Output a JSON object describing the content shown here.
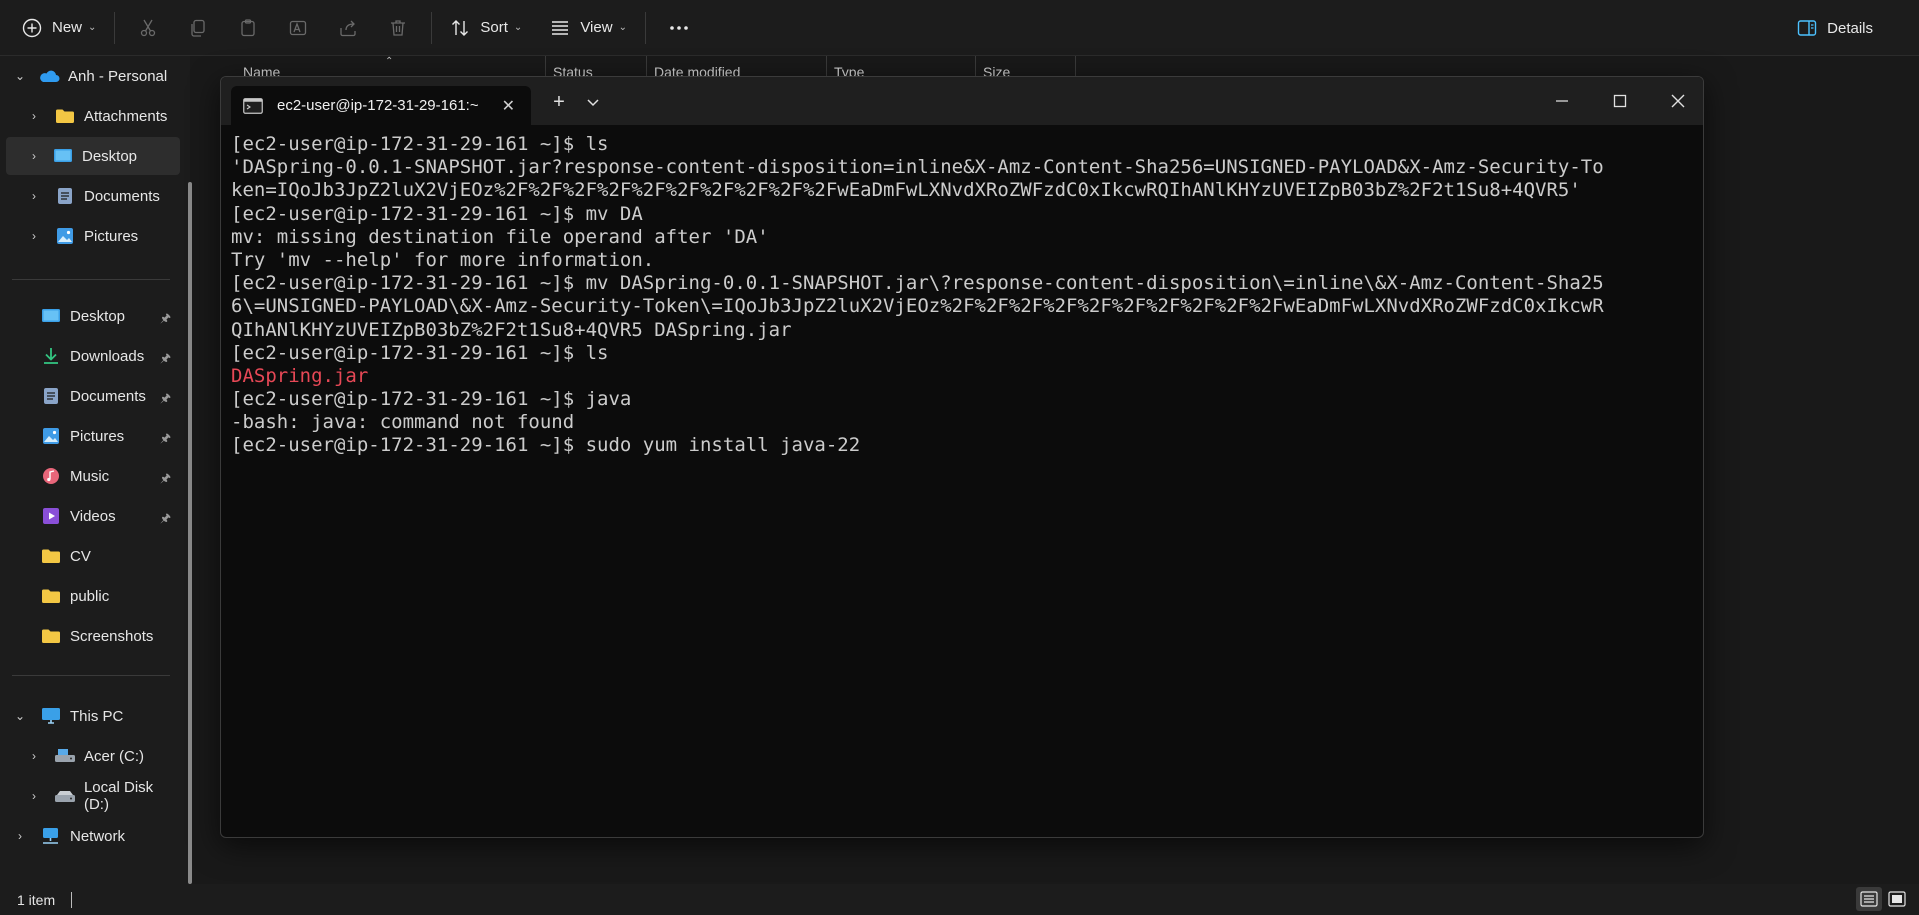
{
  "toolbar": {
    "new_label": "New",
    "sort_label": "Sort",
    "view_label": "View",
    "details_label": "Details",
    "icons": [
      "cut-icon",
      "copy-icon",
      "paste-icon",
      "rename-icon",
      "share-icon",
      "delete-icon",
      "more-icon"
    ]
  },
  "sidebar": {
    "onedrive": {
      "label": "Anh - Personal"
    },
    "onedrive_children": [
      {
        "label": "Attachments",
        "icon": "folder-icon"
      },
      {
        "label": "Desktop",
        "icon": "desktop-icon",
        "selected": true
      },
      {
        "label": "Documents",
        "icon": "documents-icon"
      },
      {
        "label": "Pictures",
        "icon": "pictures-icon"
      }
    ],
    "quick_access": [
      {
        "label": "Desktop",
        "icon": "desktop-icon",
        "pinned": true
      },
      {
        "label": "Downloads",
        "icon": "downloads-icon",
        "pinned": true
      },
      {
        "label": "Documents",
        "icon": "documents-icon",
        "pinned": true
      },
      {
        "label": "Pictures",
        "icon": "pictures-icon",
        "pinned": true
      },
      {
        "label": "Music",
        "icon": "music-icon",
        "pinned": true
      },
      {
        "label": "Videos",
        "icon": "videos-icon",
        "pinned": true
      },
      {
        "label": "CV",
        "icon": "folder-icon",
        "pinned": false
      },
      {
        "label": "public",
        "icon": "folder-icon",
        "pinned": false
      },
      {
        "label": "Screenshots",
        "icon": "folder-icon",
        "pinned": false
      }
    ],
    "this_pc": {
      "label": "This PC"
    },
    "drives": [
      {
        "label": "Acer (C:)"
      },
      {
        "label": "Local Disk (D:)"
      }
    ],
    "network": {
      "label": "Network"
    }
  },
  "columns": [
    "Name",
    "Status",
    "Date modified",
    "Type",
    "Size"
  ],
  "status": {
    "text": "1 item"
  },
  "terminal": {
    "tab_title": "ec2-user@ip-172-31-29-161:~",
    "lines": [
      {
        "text": "[ec2-user@ip-172-31-29-161 ~]$ ls",
        "color": "normal"
      },
      {
        "text": "'DASpring-0.0.1-SNAPSHOT.jar?response-content-disposition=inline&X-Amz-Content-Sha256=UNSIGNED-PAYLOAD&X-Amz-Security-To",
        "color": "normal"
      },
      {
        "text": "ken=IQoJb3JpZ2luX2VjEOz%2F%2F%2F%2F%2F%2F%2F%2F%2F%2FwEaDmFwLXNvdXRoZWFzdC0xIkcwRQIhANlKHYzUVEIZpB03bZ%2F2t1Su8+4QVR5'",
        "color": "normal"
      },
      {
        "text": "[ec2-user@ip-172-31-29-161 ~]$ mv DA",
        "color": "normal"
      },
      {
        "text": "mv: missing destination file operand after 'DA'",
        "color": "normal"
      },
      {
        "text": "Try 'mv --help' for more information.",
        "color": "normal"
      },
      {
        "text": "[ec2-user@ip-172-31-29-161 ~]$ mv DASpring-0.0.1-SNAPSHOT.jar\\?response-content-disposition\\=inline\\&X-Amz-Content-Sha25",
        "color": "normal"
      },
      {
        "text": "6\\=UNSIGNED-PAYLOAD\\&X-Amz-Security-Token\\=IQoJb3JpZ2luX2VjEOz%2F%2F%2F%2F%2F%2F%2F%2F%2F%2FwEaDmFwLXNvdXRoZWFzdC0xIkcwR",
        "color": "normal"
      },
      {
        "text": "QIhANlKHYzUVEIZpB03bZ%2F2t1Su8+4QVR5 DASpring.jar",
        "color": "normal"
      },
      {
        "text": "[ec2-user@ip-172-31-29-161 ~]$ ls",
        "color": "normal"
      },
      {
        "text": "DASpring.jar",
        "color": "red"
      },
      {
        "text": "[ec2-user@ip-172-31-29-161 ~]$ java",
        "color": "normal"
      },
      {
        "text": "-bash: java: command not found",
        "color": "normal"
      },
      {
        "text": "[ec2-user@ip-172-31-29-161 ~]$ sudo yum install java-22",
        "color": "normal"
      }
    ]
  }
}
